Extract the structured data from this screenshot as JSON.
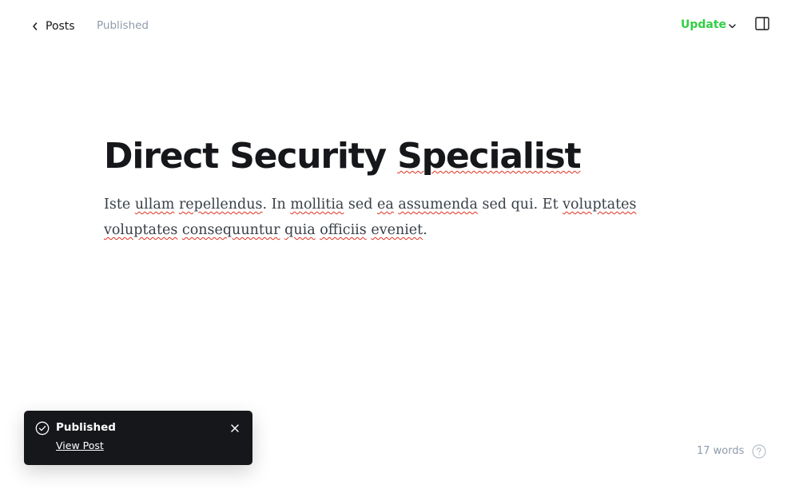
{
  "header": {
    "back_label": "Posts",
    "status": "Published",
    "update_label": "Update"
  },
  "post": {
    "title": "Direct Security Specialist",
    "body_words": [
      {
        "t": "Iste ",
        "s": false
      },
      {
        "t": "ullam",
        "s": true
      },
      {
        "t": " ",
        "s": false
      },
      {
        "t": "repellendus",
        "s": true
      },
      {
        "t": ". In ",
        "s": false
      },
      {
        "t": "mollitia",
        "s": true
      },
      {
        "t": " sed ",
        "s": false
      },
      {
        "t": "ea",
        "s": true
      },
      {
        "t": " ",
        "s": false
      },
      {
        "t": "assumenda",
        "s": true
      },
      {
        "t": " sed qui. Et ",
        "s": false
      },
      {
        "t": "voluptates",
        "s": true
      },
      {
        "t": " ",
        "s": false
      },
      {
        "t": "voluptates",
        "s": true
      },
      {
        "t": " ",
        "s": false
      },
      {
        "t": "consequuntur",
        "s": true
      },
      {
        "t": " ",
        "s": false
      },
      {
        "t": "quia",
        "s": true
      },
      {
        "t": " ",
        "s": false
      },
      {
        "t": "officiis",
        "s": true
      },
      {
        "t": " ",
        "s": false
      },
      {
        "t": "eveniet",
        "s": true
      },
      {
        "t": ".",
        "s": false
      }
    ]
  },
  "toast": {
    "title": "Published",
    "link_label": "View Post"
  },
  "footer": {
    "word_count": "17 words"
  },
  "colors": {
    "accent_green": "#30cf43",
    "toast_bg": "#15171a",
    "muted": "#8e9cac"
  },
  "icons": {
    "back": "chevron-left-icon",
    "update_menu": "chevron-down-icon",
    "sidebar": "sidebar-toggle-icon",
    "toast_status": "check-circle-icon",
    "toast_close": "close-icon",
    "help": "help-circle-icon"
  }
}
